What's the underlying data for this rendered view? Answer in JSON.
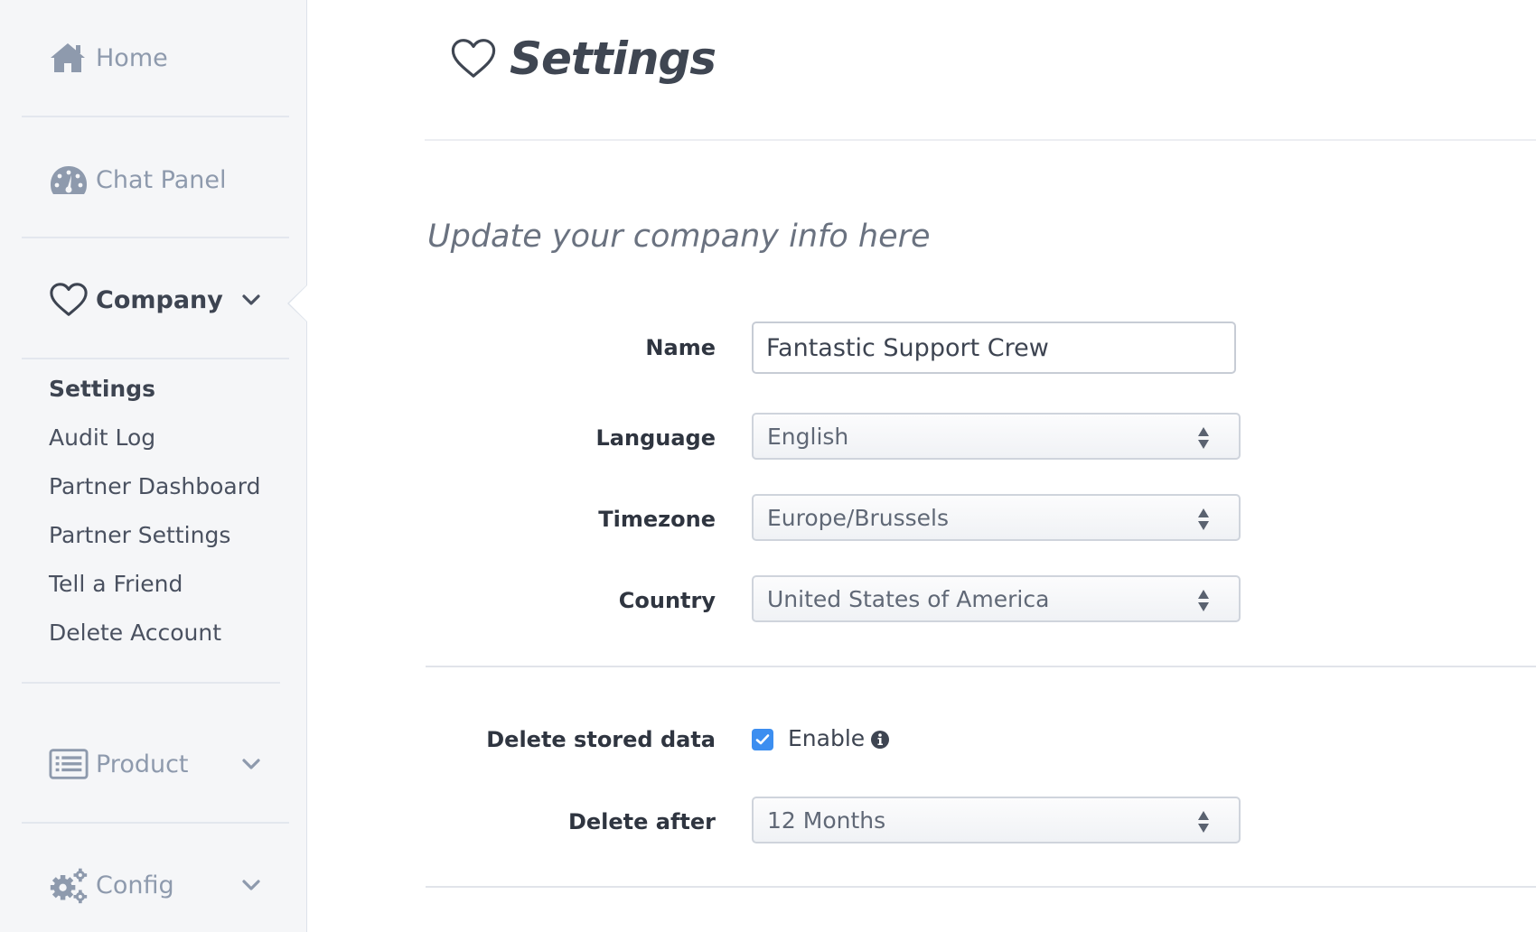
{
  "sidebar": {
    "nav": {
      "home": "Home",
      "chat_panel": "Chat Panel",
      "company": "Company",
      "product": "Product",
      "config": "Config"
    },
    "company_submenu": [
      "Settings",
      "Audit Log",
      "Partner Dashboard",
      "Partner Settings",
      "Tell a Friend",
      "Delete Account"
    ],
    "active_submenu": "Settings"
  },
  "page": {
    "title": "Settings",
    "subtitle": "Update your company info here"
  },
  "form": {
    "name_label": "Name",
    "name_value": "Fantastic Support Crew",
    "language_label": "Language",
    "language_value": "English",
    "timezone_label": "Timezone",
    "timezone_value": "Europe/Brussels",
    "country_label": "Country",
    "country_value": "United States of America",
    "delete_stored_data_label": "Delete stored data",
    "enable_label": "Enable",
    "enable_checked": true,
    "delete_after_label": "Delete after",
    "delete_after_value": "12 Months"
  },
  "colors": {
    "sidebar_bg": "#f5f6f8",
    "icon_gray": "#8e9aad",
    "checkbox_blue": "#3c8ef0",
    "text_dark": "#2f3540"
  }
}
